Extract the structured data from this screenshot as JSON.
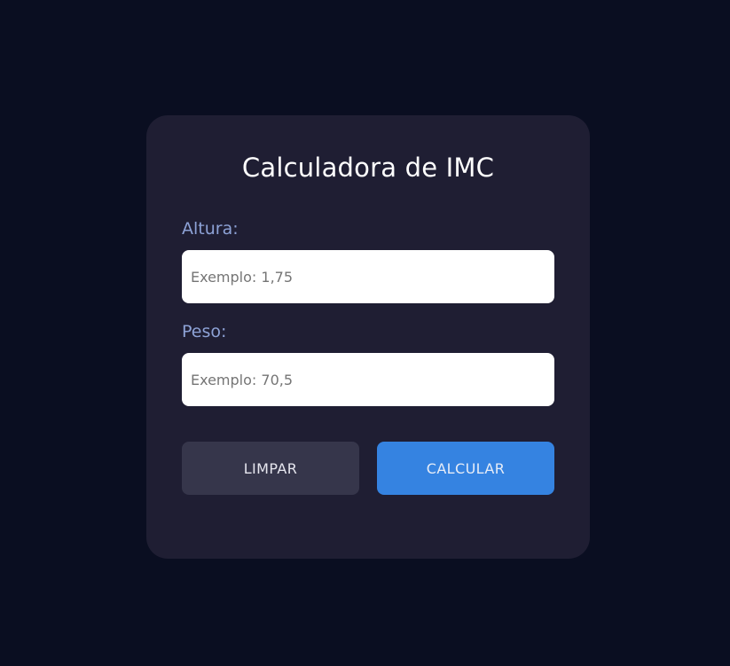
{
  "title": "Calculadora de IMC",
  "form": {
    "height_label": "Altura:",
    "height_placeholder": "Exemplo: 1,75",
    "height_value": "",
    "weight_label": "Peso:",
    "weight_placeholder": "Exemplo: 70,5",
    "weight_value": ""
  },
  "buttons": {
    "clear_label": "LIMPAR",
    "calculate_label": "CALCULAR"
  },
  "colors": {
    "background": "#0a0e21",
    "card": "#1f1e33",
    "label": "#8da2d6",
    "clear_button": "#36364b",
    "calculate_button": "#3583e1"
  }
}
